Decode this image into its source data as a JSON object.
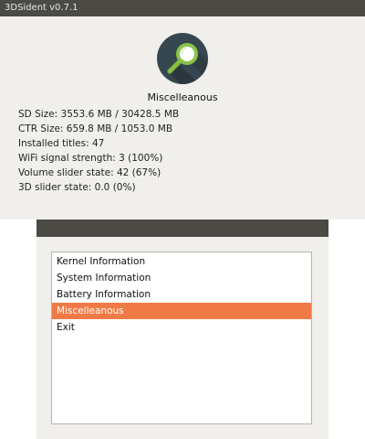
{
  "window": {
    "title": "3DSident v0.7.1"
  },
  "top_screen": {
    "icon": "search-magnifier-icon",
    "section_title": "Miscelleanous",
    "info": [
      "SD Size: 3553.6 MB / 30428.5 MB",
      "CTR Size: 659.8 MB / 1053.0 MB",
      "Installed titles: 47",
      "WiFi signal strength: 3 (100%)",
      "Volume slider state: 42 (67%)",
      "3D slider state: 0.0 (0%)"
    ]
  },
  "menu": {
    "items": [
      "Kernel Information",
      "System Information",
      "Battery Information",
      "Miscelleanous",
      "Exit"
    ],
    "selected_index": 3
  },
  "colors": {
    "bar": "#4b4a45",
    "background": "#f0efeb",
    "selected": "#f07a45",
    "icon_circle": "#37474f",
    "icon_accent": "#8bc34a"
  }
}
